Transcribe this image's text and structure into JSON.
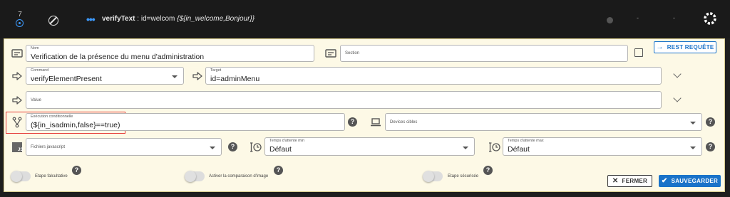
{
  "step": {
    "number": "7"
  },
  "summary": {
    "action": "verifyText",
    "target": " : id=welcom ",
    "value": "{${in_welcome,Bonjour}}"
  },
  "header": {
    "dash1": "-",
    "dash2": "-"
  },
  "name": {
    "label": "Nom",
    "value": "Verification de la présence du menu d'administration"
  },
  "section": {
    "placeholder": "Section"
  },
  "rest_button": {
    "label": "REST REQUÊTE",
    "icon": "arrow-right-icon"
  },
  "command": {
    "label": "Command",
    "value": "verifyElementPresent"
  },
  "target": {
    "label": "Target",
    "value": "id=adminMenu"
  },
  "value_field": {
    "placeholder": "Value"
  },
  "condition": {
    "label": "Exécution conditionnelle",
    "value": "(${in_isadmin,false}==true)"
  },
  "devices": {
    "placeholder": "Devices cibles"
  },
  "js_files": {
    "placeholder": "Fichiers javascript"
  },
  "wait_min": {
    "label": "Temps d'attente min",
    "value": "Défaut"
  },
  "wait_max": {
    "label": "Temps d'attente max",
    "value": "Défaut"
  },
  "help": {
    "glyph": "?"
  },
  "toggles": {
    "optional": {
      "label": "Etape falcultative",
      "on": false
    },
    "image_compare": {
      "label": "Activer la comparaison d'image",
      "on": false
    },
    "secured": {
      "label": "Etape sécurisée",
      "on": false
    }
  },
  "close_button": {
    "label": "FERMER",
    "icon": "close-icon"
  },
  "save_button": {
    "label": "SAUVEGARDER",
    "icon": "check-icon"
  },
  "colors": {
    "accent": "#3d9bff",
    "panel": "#fdf9e6",
    "save": "#1a73c9",
    "highlight": "#e53935"
  }
}
